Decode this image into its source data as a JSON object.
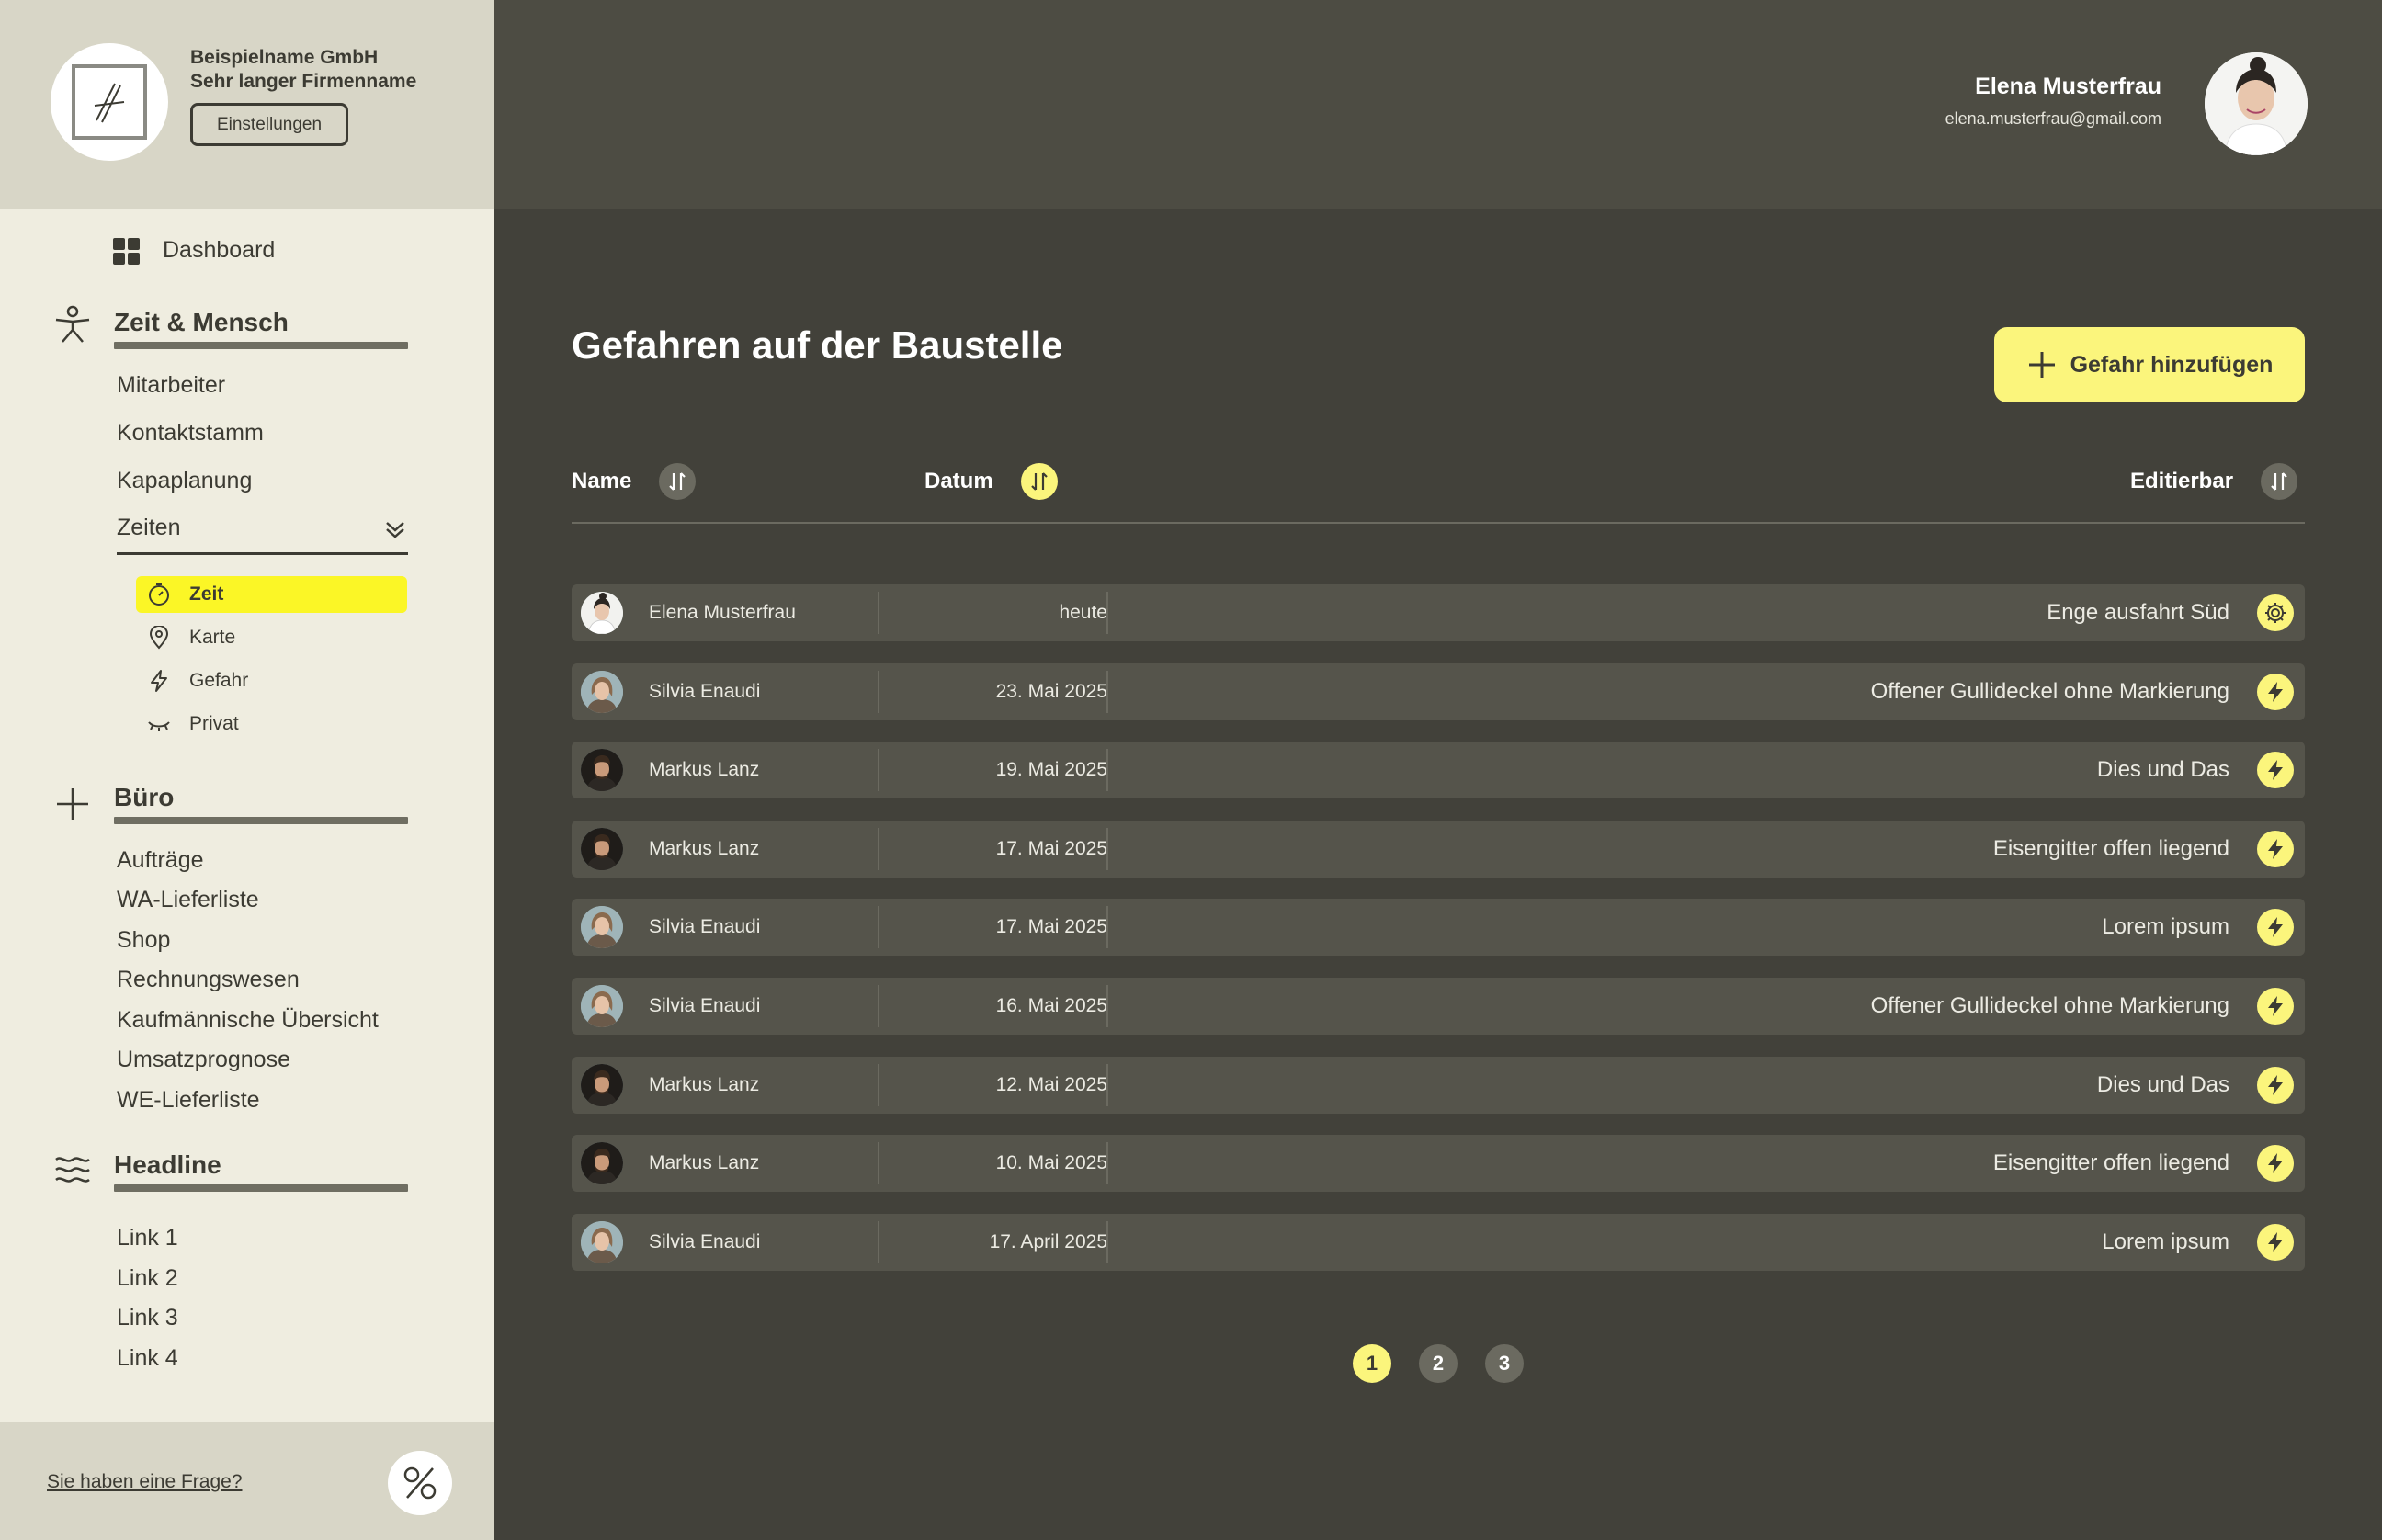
{
  "company": {
    "line1": "Beispielname GmbH",
    "line2": "Sehr langer Firmenname",
    "settings_label": "Einstellungen",
    "logo_icon": "signature-logo-icon"
  },
  "sidebar": {
    "dashboard": {
      "label": "Dashboard",
      "icon": "grid-icon"
    },
    "sections": [
      {
        "title": "Zeit & Mensch",
        "icon": "person-icon",
        "links": [
          "Mitarbeiter",
          "Kontaktstamm",
          "Kapaplanung"
        ],
        "dropdown": {
          "label": "Zeiten",
          "items": [
            {
              "label": "Zeit",
              "icon": "stopwatch-icon",
              "active": true
            },
            {
              "label": "Karte",
              "icon": "location-pin-icon",
              "active": false
            },
            {
              "label": "Gefahr",
              "icon": "lightning-icon",
              "active": false
            },
            {
              "label": "Privat",
              "icon": "closed-eye-icon",
              "active": false
            }
          ]
        }
      },
      {
        "title": "Büro",
        "icon": "plus-icon",
        "links": [
          "Aufträge",
          "WA-Lieferliste",
          "Shop",
          "Rechnungswesen",
          "Kaufmännische Übersicht",
          "Umsatzprognose",
          "WE-Lieferliste"
        ]
      },
      {
        "title": "Headline",
        "icon": "waves-icon",
        "links": [
          "Link 1",
          "Link 2",
          "Link 3",
          "Link 4"
        ]
      }
    ],
    "footer": {
      "question": "Sie haben eine Frage?",
      "badge_icon": "percent-icon"
    }
  },
  "user": {
    "name": "Elena Musterfrau",
    "email": "elena.musterfrau@gmail.com"
  },
  "main": {
    "title": "Gefahren auf der Baustelle",
    "add_label": "Gefahr hinzufügen",
    "columns": {
      "name": "Name",
      "date": "Datum",
      "editable": "Editierbar"
    },
    "rows": [
      {
        "name": "Elena Musterfrau",
        "date": "heute",
        "description": "Enge ausfahrt Süd",
        "action_icon": "gear-icon",
        "avatar": "elena"
      },
      {
        "name": "Silvia Enaudi",
        "date": "23. Mai 2025",
        "description": "Offener Gullideckel ohne Markierung",
        "action_icon": "lightning-icon",
        "avatar": "silvia"
      },
      {
        "name": "Markus Lanz",
        "date": "19. Mai 2025",
        "description": "Dies und Das",
        "action_icon": "lightning-icon",
        "avatar": "markus"
      },
      {
        "name": "Markus Lanz",
        "date": "17. Mai 2025",
        "description": "Eisengitter offen liegend",
        "action_icon": "lightning-icon",
        "avatar": "markus"
      },
      {
        "name": "Silvia Enaudi",
        "date": "17. Mai 2025",
        "description": "Lorem ipsum",
        "action_icon": "lightning-icon",
        "avatar": "silvia"
      },
      {
        "name": "Silvia Enaudi",
        "date": "16. Mai 2025",
        "description": "Offener Gullideckel ohne Markierung",
        "action_icon": "lightning-icon",
        "avatar": "silvia"
      },
      {
        "name": "Markus Lanz",
        "date": "12. Mai 2025",
        "description": "Dies und Das",
        "action_icon": "lightning-icon",
        "avatar": "markus"
      },
      {
        "name": "Markus Lanz",
        "date": "10. Mai 2025",
        "description": "Eisengitter offen liegend",
        "action_icon": "lightning-icon",
        "avatar": "markus"
      },
      {
        "name": "Silvia Enaudi",
        "date": "17. April 2025",
        "description": "Lorem ipsum",
        "action_icon": "lightning-icon",
        "avatar": "silvia"
      }
    ],
    "pagination": {
      "pages": [
        "1",
        "2",
        "3"
      ],
      "current": "1"
    }
  },
  "colors": {
    "accent_yellow": "#fbf57c",
    "active_yellow": "#fbf626",
    "background": "#42413a",
    "sidebar": "#efede0"
  }
}
